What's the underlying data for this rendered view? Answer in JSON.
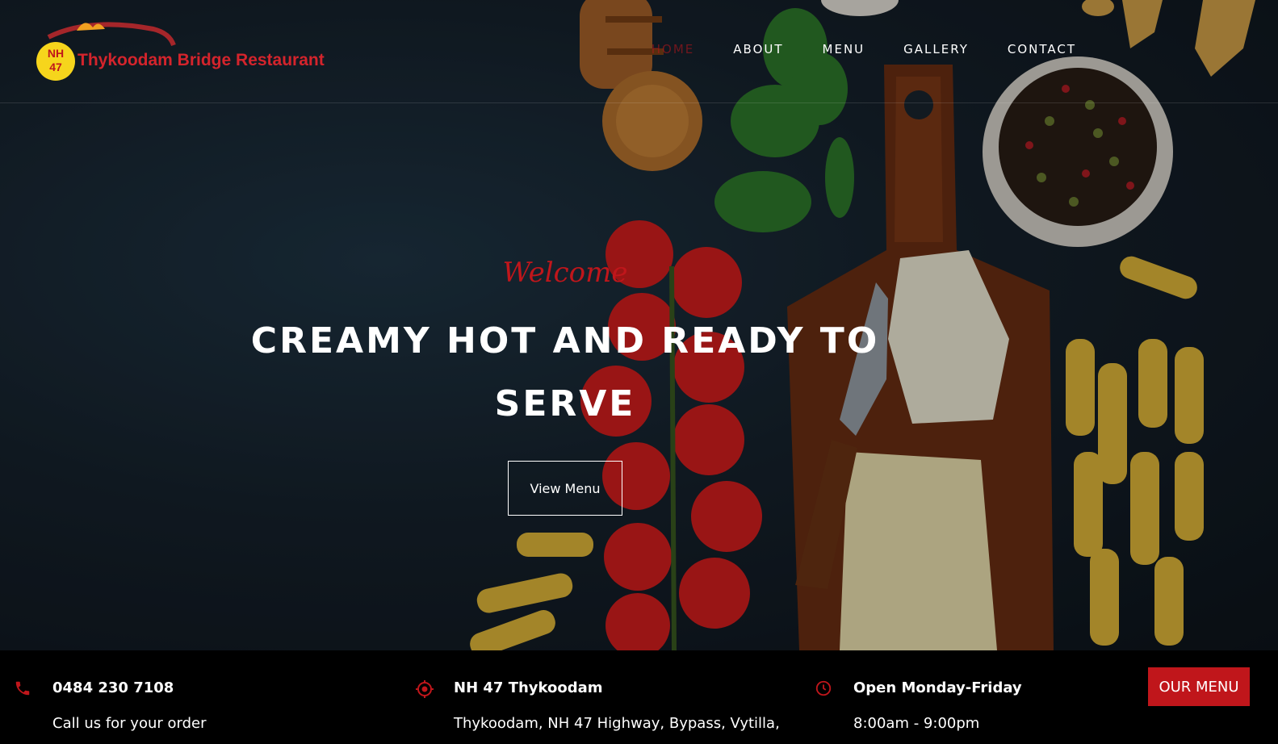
{
  "brand": {
    "badge_line1": "NH",
    "badge_line2": "47",
    "name": "Thykoodam Bridge Restaurant"
  },
  "nav": {
    "items": [
      {
        "label": "HOME",
        "active": true
      },
      {
        "label": "ABOUT"
      },
      {
        "label": "MENU"
      },
      {
        "label": "GALLERY"
      },
      {
        "label": "CONTACT"
      }
    ]
  },
  "hero": {
    "welcome": "Welcome",
    "headline": "CREAMY HOT AND READY TO SERVE",
    "cta_label": "View Menu"
  },
  "info_bar": {
    "phone": {
      "icon": "phone-icon",
      "title": "0484 230 7108",
      "subtitle": "Call us for your order"
    },
    "location": {
      "icon": "location-target-icon",
      "title": "NH 47 Thykoodam",
      "subtitle": "Thykoodam, NH 47 Highway, Bypass, Vytilla,"
    },
    "hours": {
      "icon": "clock-icon",
      "title": "Open Monday-Friday",
      "subtitle": "8:00am - 9:00pm"
    },
    "button_label": "OUR MENU"
  },
  "colors": {
    "accent": "#c0161b",
    "badge": "#f6d51c",
    "background": "#000000"
  }
}
